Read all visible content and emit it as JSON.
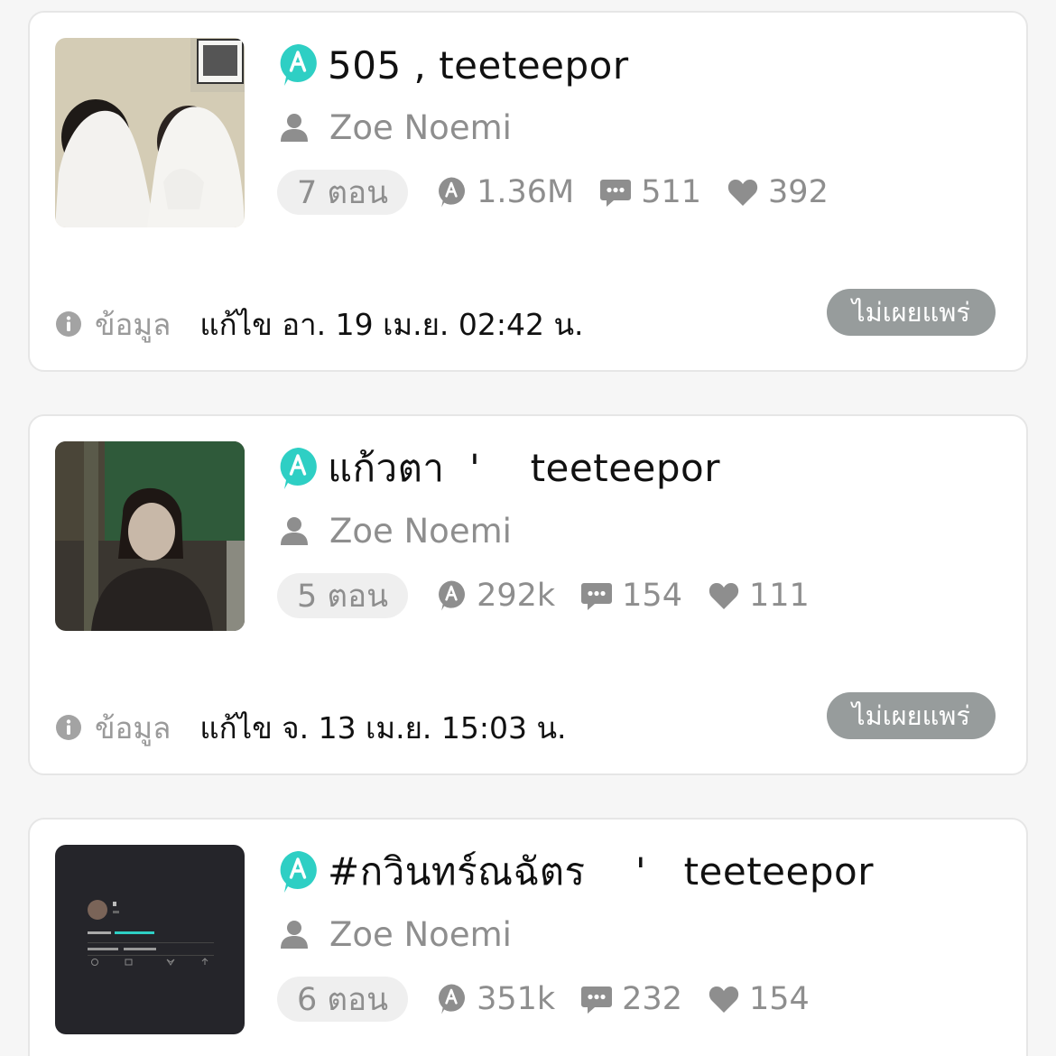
{
  "colors": {
    "brand_badge": "#2ecfc4",
    "muted_text": "#8e8e8e",
    "unpublish_button_bg": "#979c9c",
    "pill_bg": "#efefef"
  },
  "icons": {
    "brand": "a-badge-icon",
    "author": "user-icon",
    "views": "a-badge-icon",
    "comments": "comment-icon",
    "likes": "heart-icon",
    "info": "info-icon"
  },
  "stories": [
    {
      "title": "505   , teeteepor",
      "author": "Zoe Noemi",
      "episodes": "7 ตอน",
      "views": "1.36M",
      "comments": "511",
      "likes": "392",
      "info_label": "ข้อมูล",
      "edited": "แก้ไข อา. 19 เม.ย. 02:42 น.",
      "status_button": "ไม่เผยแพร่"
    },
    {
      "title": "แก้วตา  '    teeteepor",
      "author": "Zoe Noemi",
      "episodes": "5 ตอน",
      "views": "292k",
      "comments": "154",
      "likes": "111",
      "info_label": "ข้อมูล",
      "edited": "แก้ไข จ. 13 เม.ย. 15:03 น.",
      "status_button": "ไม่เผยแพร่"
    },
    {
      "title": "#กวินทร์ณฉัตร    '   teeteepor",
      "author": "Zoe Noemi",
      "episodes": "6 ตอน",
      "views": "351k",
      "comments": "232",
      "likes": "154"
    }
  ]
}
